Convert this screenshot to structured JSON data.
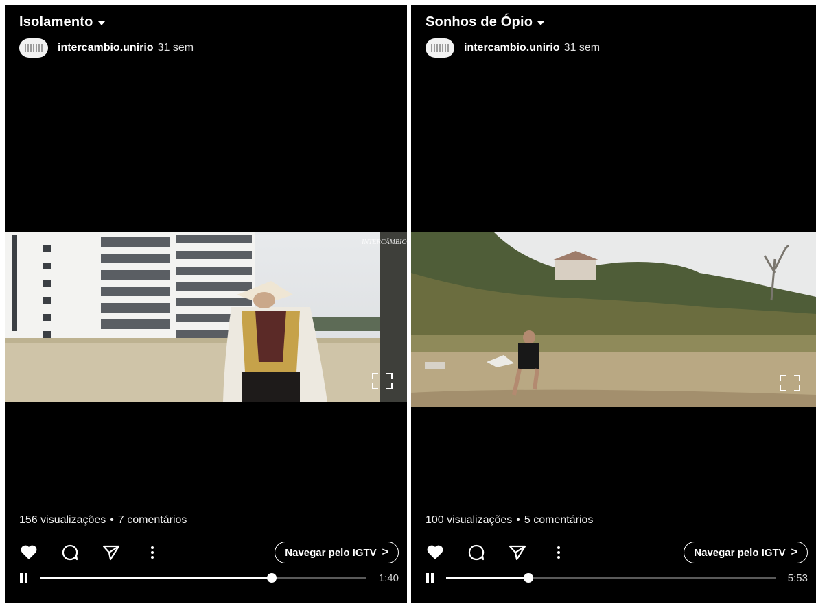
{
  "panels": [
    {
      "title": "Isolamento",
      "author": "intercambio.unirio",
      "age": "31 sem",
      "views": "156 visualizações",
      "separator": "•",
      "comments": "7 comentários",
      "igtv_label": "Navegar pelo IGTV",
      "duration": "1:40",
      "progress": 0.71,
      "video_watermark": "INTERCÂMBIO"
    },
    {
      "title": "Sonhos de Ópio",
      "author": "intercambio.unirio",
      "age": "31 sem",
      "views": "100 visualizações",
      "separator": "•",
      "comments": "5 comentários",
      "igtv_label": "Navegar pelo IGTV",
      "duration": "5:53",
      "progress": 0.25
    }
  ],
  "icons": {
    "like": "heart-icon",
    "comment": "comment-icon",
    "share": "send-icon",
    "more": "more-vertical-icon",
    "expand": "fullscreen-icon",
    "play_state": "pause-icon",
    "chevron": "chevron-right-icon"
  },
  "colors": {
    "background": "#000000",
    "text": "#ffffff",
    "track": "#5a5a5a"
  }
}
